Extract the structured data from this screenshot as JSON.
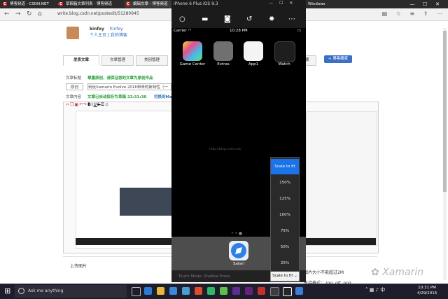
{
  "browser": {
    "tabs": [
      {
        "label": "博客频道 - CSDN.NET",
        "active": false
      },
      {
        "label": "草稿箱文章列表 - 博客频道",
        "active": false
      },
      {
        "label": "编辑文章 - 博客频道",
        "active": true
      }
    ],
    "window_label": "Windows",
    "url": "write.blog.csdn.net/postedit/51280945",
    "window_controls": {
      "min": "—",
      "max": "☐",
      "close": "✕"
    }
  },
  "page": {
    "username": "kinfey",
    "username_link": "Kinfey",
    "home_link": "个人主页",
    "my_blog": "我的博客",
    "tabs": [
      "发表文章",
      "文章管理",
      "类别管理",
      "",
      "",
      "",
      "收藏",
      ""
    ],
    "blog_move_btn": "+ 博客搬家",
    "title_label": "文章标题",
    "title_notice": "尊重原创，请保证您的文章为原创作品",
    "category_select": "原创",
    "title_value": "玩玩Xamarin Evolve 2016带来的新特性（一",
    "content_label": "文章内容",
    "autosave": "文章已自动保存为草稿 22:31:30",
    "switch_to": "切换到Mark",
    "upload_label": "上传图片",
    "upload_hint1": "图片大小不能超过2M",
    "upload_hint2": "支持格式：.jpg .gif .png .bmp"
  },
  "simulator": {
    "title": "iPhone 6 Plus iOS 9.3",
    "carrier": "Carrier",
    "time": "10:28 PM",
    "apps": [
      "Game Center",
      "Extras",
      "App1",
      "Watch"
    ],
    "watermark": "http://blog.csdn.net/",
    "dock_app": "Safari",
    "touch_mode": "Touch Mode: Shallow Press",
    "scale_value": "Scale to fit",
    "scale_options": [
      "Scale to fit",
      "150%",
      "125%",
      "100%",
      "75%",
      "50%",
      "25%"
    ],
    "selected_option": "Scale to fit"
  },
  "taskbar": {
    "search_placeholder": "Ask me anything",
    "time": "10:31 PM",
    "date": "4/29/2016"
  },
  "watermark_brand": "Xamarin",
  "colors": {
    "accent": "#1a73e8",
    "taskbar": "#1d1d2b",
    "tab_red": "#c9211e",
    "green_text": "#1f9c31"
  }
}
